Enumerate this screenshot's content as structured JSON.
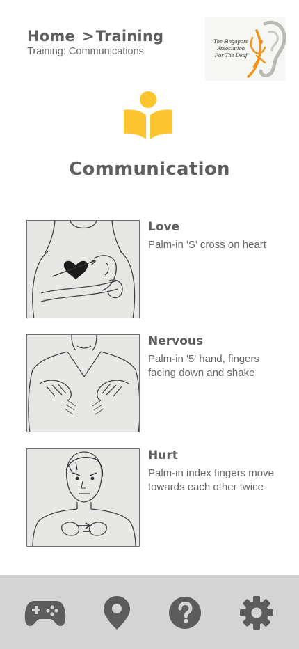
{
  "header": {
    "breadcrumb_home": "Home",
    "breadcrumb_separator": ">",
    "breadcrumb_current": "Training",
    "subtitle": "Training: Communications"
  },
  "logo": {
    "line1": "The Singapore",
    "line2": "Association",
    "line3": "For The Deaf"
  },
  "page": {
    "icon": "book-reader-icon",
    "title": "Communication"
  },
  "signs": [
    {
      "name": "Love",
      "description": "Palm-in 'S' cross on heart"
    },
    {
      "name": "Nervous",
      "description": "Palm-in '5' hand, fingers facing down and shake"
    },
    {
      "name": "Hurt",
      "description": "Palm-in index fingers move towards each other twice"
    }
  ],
  "bottom_nav": [
    "gamepad-icon",
    "map-pin-icon",
    "help-icon",
    "settings-gear-icon"
  ],
  "colors": {
    "accent": "#fcc42e",
    "logo_orange": "#f0941c",
    "text": "#5f5f5f",
    "nav_bg": "#d4d4d4",
    "nav_icon": "#5c5c5c"
  }
}
